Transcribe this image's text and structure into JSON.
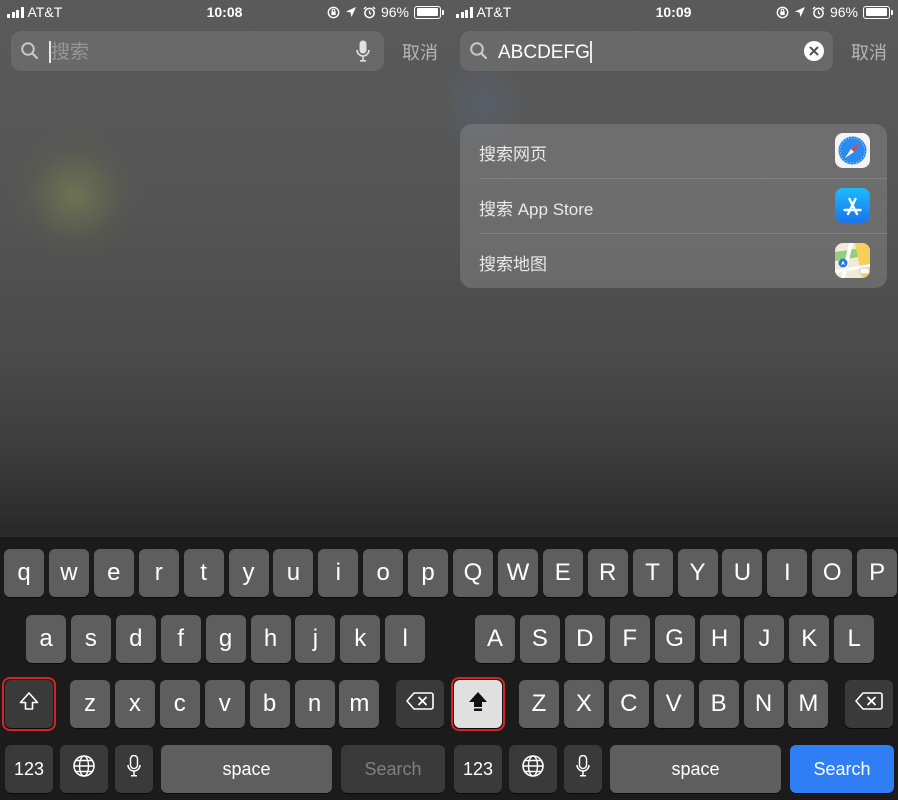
{
  "left": {
    "status": {
      "carrier": "AT&T",
      "time": "10:08",
      "battery": "96%",
      "battery_level": 0.96
    },
    "search": {
      "placeholder": "搜索",
      "value": "",
      "cancel_label": "取消"
    },
    "keyboard": {
      "row1": [
        "q",
        "w",
        "e",
        "r",
        "t",
        "y",
        "u",
        "i",
        "o",
        "p"
      ],
      "row2": [
        "a",
        "s",
        "d",
        "f",
        "g",
        "h",
        "j",
        "k",
        "l"
      ],
      "row3": [
        "z",
        "x",
        "c",
        "v",
        "b",
        "n",
        "m"
      ],
      "numbers_label": "123",
      "space_label": "space",
      "return_label": "Search",
      "return_enabled": false,
      "shift_active": false
    }
  },
  "right": {
    "status": {
      "carrier": "AT&T",
      "time": "10:09",
      "battery": "96%",
      "battery_level": 0.96
    },
    "search": {
      "value": "ABCDEFG",
      "cancel_label": "取消"
    },
    "suggestions": [
      {
        "label": "搜索网页",
        "icon": "safari-icon"
      },
      {
        "label": "搜索 App Store",
        "icon": "app-store-icon"
      },
      {
        "label": "搜索地图",
        "icon": "maps-icon"
      }
    ],
    "keyboard": {
      "row1": [
        "Q",
        "W",
        "E",
        "R",
        "T",
        "Y",
        "U",
        "I",
        "O",
        "P"
      ],
      "row2": [
        "A",
        "S",
        "D",
        "F",
        "G",
        "H",
        "J",
        "K",
        "L"
      ],
      "row3": [
        "Z",
        "X",
        "C",
        "V",
        "B",
        "N",
        "M"
      ],
      "numbers_label": "123",
      "space_label": "space",
      "return_label": "Search",
      "return_enabled": true,
      "shift_active": true
    }
  },
  "colors": {
    "keyboard_key": "#5e5e5e",
    "keyboard_func_key": "#3a3a3a",
    "search_key_active": "#2f7ef6",
    "highlight_ring": "#d5232a"
  }
}
